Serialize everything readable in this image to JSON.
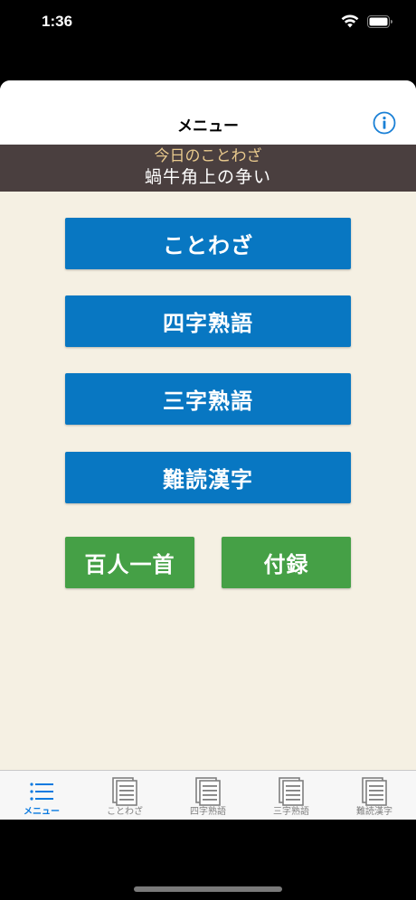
{
  "status_bar": {
    "time": "1:36"
  },
  "nav": {
    "title": "メニュー",
    "info_icon": "info-circle-icon"
  },
  "proverb": {
    "caption": "今日のことわざ",
    "text": "蝸牛角上の争い"
  },
  "menu_buttons": {
    "kotowaza": "ことわざ",
    "yoji": "四字熟語",
    "sanji": "三字熟語",
    "nandoku": "難読漢字",
    "hyakunin": "百人一首",
    "furoku": "付録"
  },
  "tab_bar": {
    "items": [
      {
        "label": "メニュー",
        "icon": "list-icon",
        "active": true
      },
      {
        "label": "ことわざ",
        "icon": "document-icon",
        "active": false
      },
      {
        "label": "四字熟語",
        "icon": "document-icon",
        "active": false
      },
      {
        "label": "三字熟語",
        "icon": "document-icon",
        "active": false
      },
      {
        "label": "難読漢字",
        "icon": "document-icon",
        "active": false
      }
    ]
  },
  "colors": {
    "button_blue": "#0877c2",
    "button_green": "#45a046",
    "banner_bg": "#4a3f3f",
    "banner_caption": "#e8c98d",
    "content_bg": "#f5f0e3",
    "tab_active": "#0a7ae0",
    "tab_inactive": "#7f7f7f"
  }
}
